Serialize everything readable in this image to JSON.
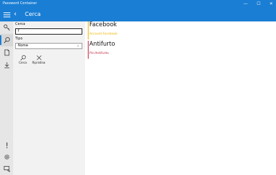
{
  "window": {
    "title": "Password Container",
    "controls": {
      "minimize": "—",
      "maximize": "☐",
      "close": "✕"
    }
  },
  "header": {
    "title": "Cerca",
    "back_glyph": "‹"
  },
  "rail": {
    "items": [
      {
        "icon": "key-icon",
        "selected": false
      },
      {
        "icon": "search-icon",
        "selected": true
      },
      {
        "icon": "document-icon",
        "selected": false
      },
      {
        "icon": "download-icon",
        "selected": false
      }
    ],
    "bottom_items": [
      {
        "icon": "exclamation-icon"
      },
      {
        "icon": "gear-icon"
      },
      {
        "icon": "feedback-icon"
      }
    ]
  },
  "search": {
    "search_label": "Cerca",
    "search_value": "f",
    "type_label": "Tipo",
    "type_selected": "Nome",
    "search_button": "Cerca",
    "reset_button": "Ripristina"
  },
  "results": [
    {
      "name": "Facebook",
      "sub": "Account:Facebook",
      "color": "#f0b400"
    },
    {
      "name": "Antifurto",
      "sub": "Pin:Antifurto",
      "color": "#c4203a"
    }
  ],
  "colors": {
    "accent": "#1a7ed4"
  }
}
